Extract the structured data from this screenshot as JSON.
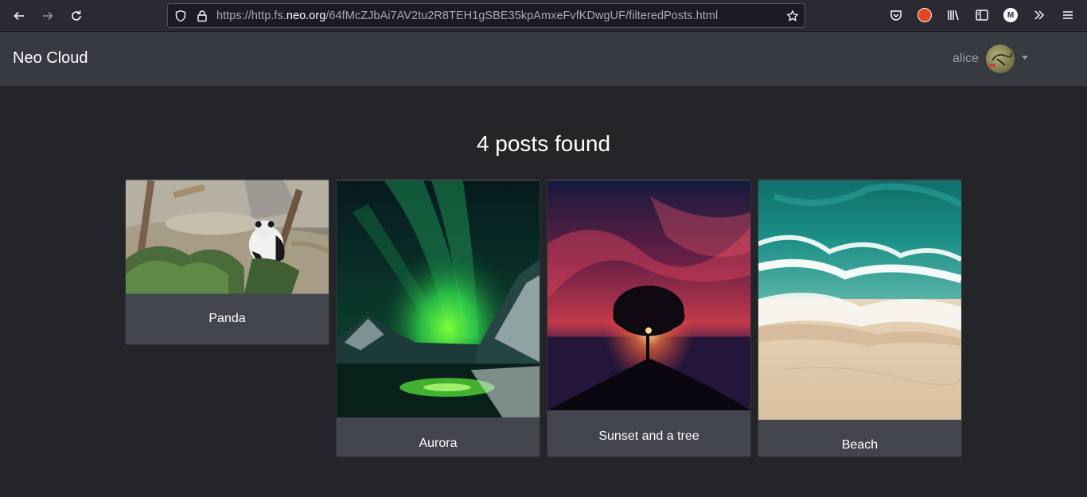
{
  "browser": {
    "url_prefix": "https://http.fs.",
    "url_domain": "neo.org",
    "url_path": "/64fMcZJbAi7AV2tu2R8TEH1gSBE35kpAmxeFvfKDwgUF/filteredPosts.html"
  },
  "navbar": {
    "brand": "Neo Cloud",
    "username": "alice"
  },
  "main": {
    "heading": "4 posts found",
    "posts": [
      {
        "title": "Panda"
      },
      {
        "title": "Aurora"
      },
      {
        "title": "Sunset and a tree"
      },
      {
        "title": "Beach"
      }
    ]
  }
}
